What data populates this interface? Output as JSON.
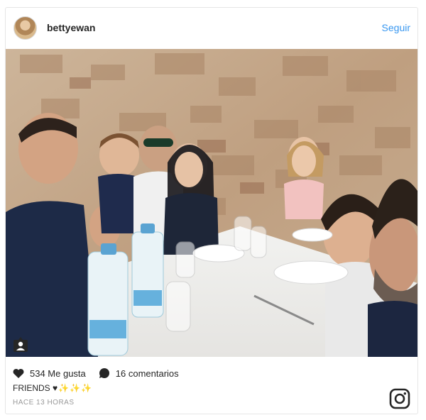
{
  "header": {
    "username": "bettyewan",
    "follow_label": "Seguir"
  },
  "footer": {
    "likes_label": "534 Me gusta",
    "comments_label": "16 comentarios",
    "caption_text": "FRIENDS",
    "caption_emoji": "♥✨✨✨",
    "timestamp": "HACE 13 HORAS"
  },
  "icons": {
    "avatar": "user-avatar",
    "tag": "tag-person-icon",
    "like": "heart-icon",
    "comment": "comment-bubble-icon",
    "brand": "instagram-logo-icon"
  },
  "colors": {
    "link": "#3897f0",
    "text": "#262626",
    "muted": "#999999"
  }
}
